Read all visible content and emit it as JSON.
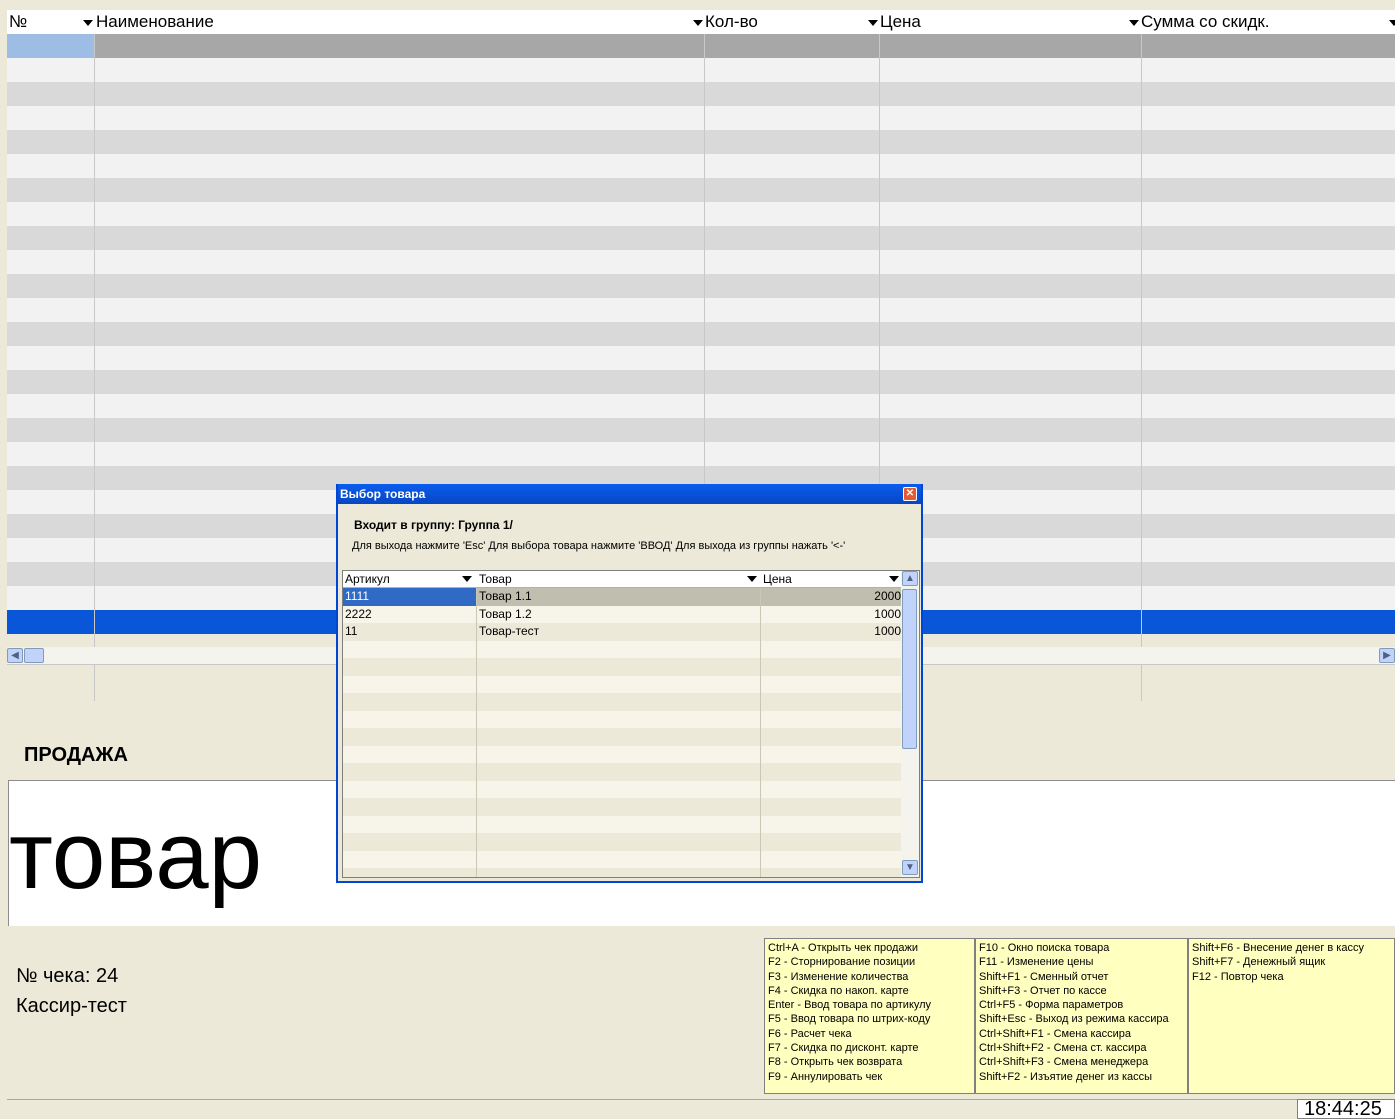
{
  "main_table": {
    "columns": [
      {
        "label": "№"
      },
      {
        "label": "Наименование"
      },
      {
        "label": "Кол-во"
      },
      {
        "label": "Цена"
      },
      {
        "label": "Сумма со скидк."
      }
    ],
    "row_count": 25
  },
  "sale": {
    "mode_label": "ПРОДАЖА",
    "display_text": "товар"
  },
  "check": {
    "number_label": "№ чека: 24",
    "cashier_label": "Кассир-тест"
  },
  "hotkeys": {
    "col1": [
      "Ctrl+A - Открыть чек продажи",
      "F2 - Сторнирование позиции",
      "F3 - Изменение количества",
      "F4 - Скидка по накоп. карте",
      "Enter - Ввод товара по артикулу",
      "F5 - Ввод товара по штрих-коду",
      "F6 - Расчет чека",
      "F7 - Скидка по дисконт. карте",
      "F8 - Открыть чек возврата",
      "F9 - Аннулировать чек"
    ],
    "col2": [
      "F10 - Окно поиска товара",
      "F11 - Изменение цены",
      "Shift+F1 - Сменный отчет",
      "Shift+F3 - Отчет по кассе",
      "Ctrl+F5 - Форма параметров",
      "Shift+Esc - Выход из режима кассира",
      "Ctrl+Shift+F1 - Смена кассира",
      "Ctrl+Shift+F2 - Смена ст. кассира",
      "Ctrl+Shift+F3 - Смена менеджера",
      "Shift+F2 - Изъятие денег из кассы"
    ],
    "col3": [
      "Shift+F6 - Внесение денег в кассу",
      "Shift+F7 - Денежный ящик",
      "F12 - Повтор чека"
    ]
  },
  "status": {
    "clock": "18:44:25"
  },
  "dialog": {
    "title": "Выбор товара",
    "close_glyph": "✕",
    "group_label": "Входит в группу: Группа 1/",
    "hint": "Для выхода нажмите 'Esc'  Для выбора товара нажмите 'ВВОД'  Для выхода из группы нажать '<-'",
    "columns": [
      {
        "label": "Артикул"
      },
      {
        "label": "Товар"
      },
      {
        "label": "Цена"
      }
    ],
    "rows": [
      {
        "article": "1111",
        "name": "Товар 1.1",
        "price": "2000"
      },
      {
        "article": "2222",
        "name": "Товар 1.2",
        "price": "1000"
      },
      {
        "article": "11",
        "name": "Товар-тест",
        "price": "1000"
      }
    ]
  },
  "colors": {
    "selection_blue": "#0a56d8",
    "row_dark": "#d9d9d9",
    "row_light": "#f2f2f2",
    "hotkey_bg": "#ffffc0",
    "dialog_title": "#0a5ded"
  }
}
